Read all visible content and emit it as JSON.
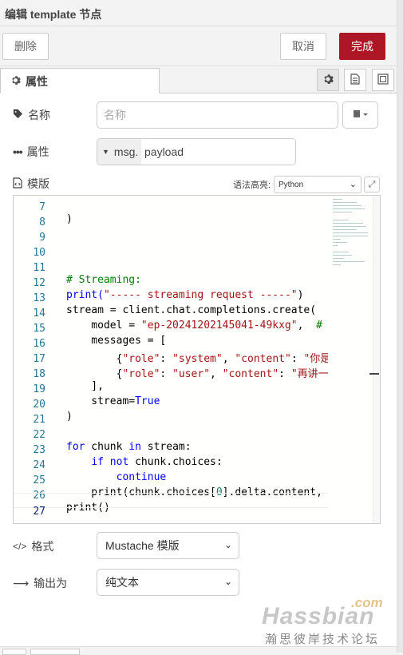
{
  "title": "编辑 template 节点",
  "actions": {
    "delete": "删除",
    "cancel": "取消",
    "done": "完成"
  },
  "tabs": {
    "properties": "属性"
  },
  "fields": {
    "name_label": "名称",
    "name_placeholder": "名称",
    "property_label": "属性",
    "property_type": "msg.",
    "property_value": "payload",
    "template_label": "模版",
    "syntax_label": "语法高亮:",
    "syntax_value": "Python",
    "format_label": "格式",
    "format_value": "Mustache 模版",
    "output_label": "输出为",
    "output_value": "纯文本"
  },
  "code_lines": [
    {
      "n": "7"
    },
    {
      "n": "8"
    },
    {
      "n": "9"
    },
    {
      "n": "10"
    },
    {
      "n": "11"
    },
    {
      "n": "12"
    },
    {
      "n": "13"
    },
    {
      "n": "14"
    },
    {
      "n": "15"
    },
    {
      "n": "16"
    },
    {
      "n": "17"
    },
    {
      "n": "18"
    },
    {
      "n": "19"
    },
    {
      "n": "20"
    },
    {
      "n": "21"
    },
    {
      "n": "22"
    },
    {
      "n": "23"
    },
    {
      "n": "24"
    },
    {
      "n": "25"
    },
    {
      "n": "26"
    },
    {
      "n": "27"
    }
  ],
  "code_text": {
    "l7": ")",
    "l11": "# Streaming:",
    "l12a": "print(",
    "l12b": "\"----- streaming request -----\"",
    "l12c": ")",
    "l13": "stream = client.chat.completions.create(",
    "l14a": "    model = ",
    "l14b": "\"ep-20241202145041-49kxg\"",
    "l14c": ",  ",
    "l14d": "# y",
    "l15": "    messages = [",
    "l16a": "        {",
    "l16b": "\"role\"",
    "l16c": ": ",
    "l16d": "\"system\"",
    "l16e": ", ",
    "l16f": "\"content\"",
    "l16g": ": ",
    "l16h": "\"你是",
    "l17a": "        {",
    "l17b": "\"role\"",
    "l17c": ": ",
    "l17d": "\"user\"",
    "l17e": ", ",
    "l17f": "\"content\"",
    "l17g": ": ",
    "l17h": "\"再讲一",
    "l18": "    ],",
    "l19a": "    stream=",
    "l19b": "True",
    "l20": ")",
    "l22a": "for",
    "l22b": " chunk ",
    "l22c": "in",
    "l22d": " stream:",
    "l23a": "    ",
    "l23b": "if not",
    "l23c": " chunk.choices:",
    "l24a": "        ",
    "l24b": "continue",
    "l25a": "    print(chunk.choices[",
    "l25b": "0",
    "l25c": "].delta.content, e",
    "l26": "print()"
  },
  "watermark": {
    "com": ".com",
    "main": "Hassbian",
    "sub": "瀚思彼岸技术论坛"
  }
}
